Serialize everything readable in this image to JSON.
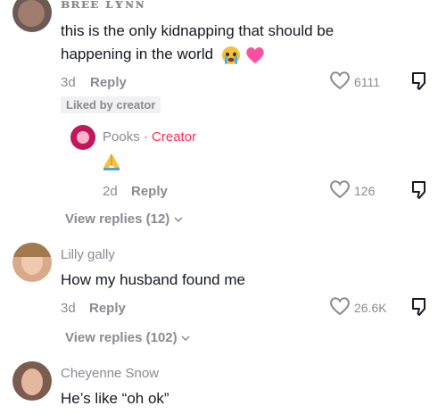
{
  "comments": [
    {
      "username": "ʙʀᴇᴇ ʟʏɴɴ",
      "text_line1": "this is the only kidnapping that should be",
      "text_line2": "happening in the world",
      "emojis": [
        "face-screaming-in-tears-icon",
        "heart-icon"
      ],
      "age": "3d",
      "reply_label": "Reply",
      "likes": "6111",
      "liked_by_creator": "Liked by creator",
      "avatar_color": "#6b5a55"
    },
    {
      "username": "Pooks",
      "creator_sep": "·",
      "creator_label": "Creator",
      "text_emoji": "🙏",
      "age": "2d",
      "reply_label": "Reply",
      "likes": "126",
      "is_reply": true,
      "avatar_color": "#c2185b"
    },
    {
      "username": "Lilly gally",
      "text": "How my husband found me",
      "age": "3d",
      "reply_label": "Reply",
      "likes": "26.6K",
      "avatar_color": "#d8a98a"
    },
    {
      "username": "Cheyenne Snow",
      "text": "He’s like “oh ok”",
      "avatar_color": "#7b5d4f"
    }
  ],
  "view_replies_1": "View replies (12)",
  "view_replies_2": "View replies (102)"
}
